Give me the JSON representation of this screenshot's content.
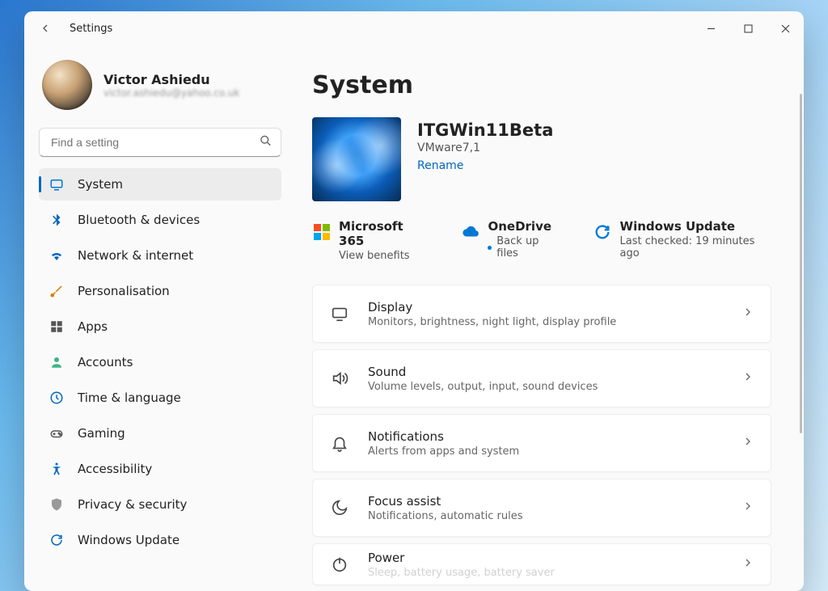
{
  "window": {
    "title": "Settings"
  },
  "user": {
    "name": "Victor Ashiedu",
    "email": "victor.ashiedu@yahoo.co.uk"
  },
  "search": {
    "placeholder": "Find a setting"
  },
  "sidebar": {
    "items": [
      {
        "label": "System"
      },
      {
        "label": "Bluetooth & devices"
      },
      {
        "label": "Network & internet"
      },
      {
        "label": "Personalisation"
      },
      {
        "label": "Apps"
      },
      {
        "label": "Accounts"
      },
      {
        "label": "Time & language"
      },
      {
        "label": "Gaming"
      },
      {
        "label": "Accessibility"
      },
      {
        "label": "Privacy & security"
      },
      {
        "label": "Windows Update"
      }
    ]
  },
  "page": {
    "title": "System",
    "device": {
      "name": "ITGWin11Beta",
      "model": "VMware7,1",
      "rename": "Rename"
    },
    "status": {
      "ms365": {
        "title": "Microsoft 365",
        "sub": "View benefits"
      },
      "onedrive": {
        "title": "OneDrive",
        "sub": "Back up files"
      },
      "update": {
        "title": "Windows Update",
        "sub": "Last checked: 19 minutes ago"
      }
    },
    "cards": [
      {
        "title": "Display",
        "sub": "Monitors, brightness, night light, display profile"
      },
      {
        "title": "Sound",
        "sub": "Volume levels, output, input, sound devices"
      },
      {
        "title": "Notifications",
        "sub": "Alerts from apps and system"
      },
      {
        "title": "Focus assist",
        "sub": "Notifications, automatic rules"
      },
      {
        "title": "Power",
        "sub": "Sleep, battery usage, battery saver"
      }
    ]
  }
}
